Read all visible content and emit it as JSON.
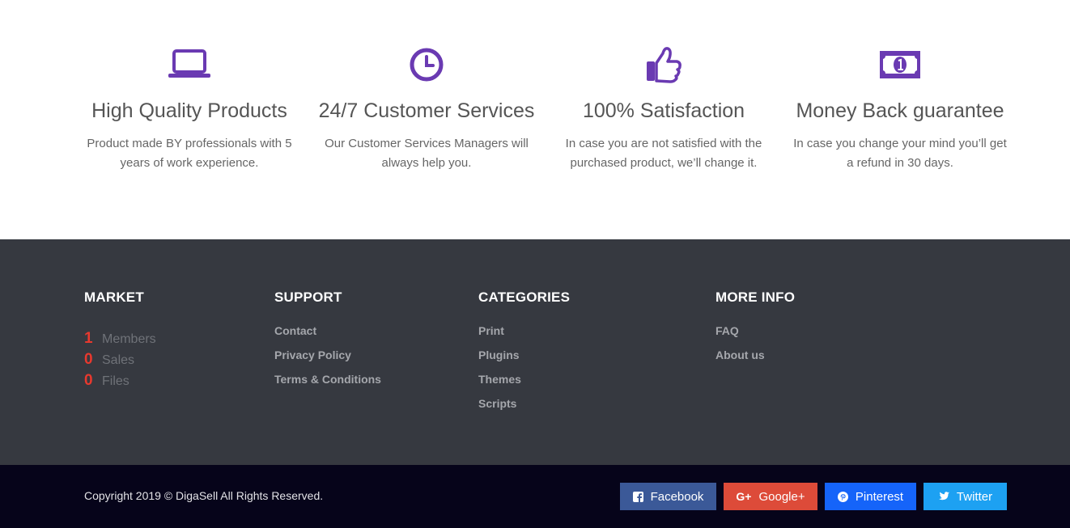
{
  "colors": {
    "accent_purple": "#6a3ab2",
    "footer_bg": "#363940",
    "bottom_bg": "#06041a",
    "stat_red": "#e8392e",
    "facebook": "#3b5998",
    "google": "#dd4b39",
    "pinterest": "#1564f9",
    "twitter": "#1da1f2"
  },
  "features": [
    {
      "icon": "laptop-icon",
      "title": "High Quality Products",
      "text": "Product made BY professionals with 5 years of work experience."
    },
    {
      "icon": "clock-icon",
      "title": "24/7 Customer Services",
      "text": "Our Customer Services Managers will always help you."
    },
    {
      "icon": "thumbs-up-icon",
      "title": "100% Satisfaction",
      "text": "In case you are not satisfied with the purchased product, we’ll change it."
    },
    {
      "icon": "money-bill-icon",
      "title": "Money Back guarantee",
      "text": "In case you change your mind you’ll get a refund in 30 days."
    }
  ],
  "footer": {
    "market": {
      "title": "MARKET",
      "stats": [
        {
          "value": "1",
          "label": "Members"
        },
        {
          "value": "0",
          "label": "Sales"
        },
        {
          "value": "0",
          "label": "Files"
        }
      ]
    },
    "support": {
      "title": "SUPPORT",
      "links": [
        "Contact",
        "Privacy Policy",
        "Terms & Conditions"
      ]
    },
    "categories": {
      "title": "CATEGORIES",
      "links": [
        "Print",
        "Plugins",
        "Themes",
        "Scripts"
      ]
    },
    "more_info": {
      "title": "MORE INFO",
      "links": [
        "FAQ",
        "About us"
      ]
    }
  },
  "bottom": {
    "copyright": "Copyright 2019 © DigaSell All Rights Reserved.",
    "social": [
      {
        "label": "Facebook",
        "icon": "facebook-icon"
      },
      {
        "label": "Google+",
        "icon": "google-plus-icon"
      },
      {
        "label": "Pinterest",
        "icon": "pinterest-icon"
      },
      {
        "label": "Twitter",
        "icon": "twitter-icon"
      }
    ]
  }
}
